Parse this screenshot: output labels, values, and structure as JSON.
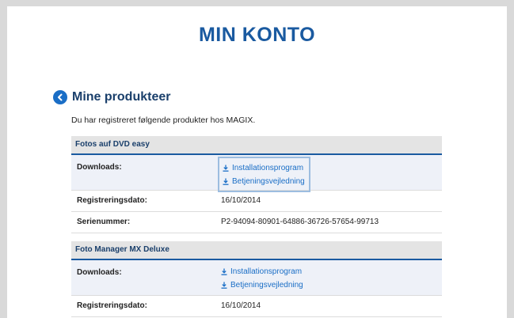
{
  "page": {
    "title": "MIN KONTO",
    "section_title": "Mine produkteer",
    "intro": "Du har registreret følgende produkter hos MAGIX."
  },
  "products": [
    {
      "name": "Fotos auf DVD easy",
      "downloads_label": "Downloads:",
      "downloads": [
        "Installationsprogram",
        "Betjeningsvejledning"
      ],
      "registration_label": "Registreringsdato:",
      "registration_date": "16/10/2014",
      "serial_label": "Serienummer:",
      "serial": "P2-94094-80901-64886-36726-57654-99713"
    },
    {
      "name": "Foto Manager MX Deluxe",
      "downloads_label": "Downloads:",
      "downloads": [
        "Installationsprogram",
        "Betjeningsvejledning"
      ],
      "registration_label": "Registreringsdato:",
      "registration_date": "16/10/2014"
    }
  ],
  "colors": {
    "brand_blue": "#1a5aa0",
    "link_blue": "#1a6ec6",
    "header_gray": "#e4e4e4",
    "row_tint": "#eef1f8"
  },
  "icons": {
    "back": "chevron-left-icon",
    "download": "download-icon"
  }
}
